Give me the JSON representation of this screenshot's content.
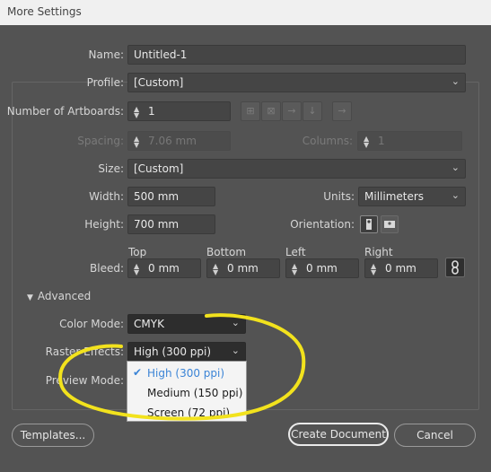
{
  "window": {
    "title": "More Settings"
  },
  "name": {
    "label": "Name:",
    "value": "Untitled-1"
  },
  "profile": {
    "label": "Profile:",
    "value": "[Custom]"
  },
  "artboards": {
    "label": "Number of Artboards:",
    "value": "1"
  },
  "spacing": {
    "label": "Spacing:",
    "value": "7.06 mm"
  },
  "columns": {
    "label": "Columns:",
    "value": "1"
  },
  "size": {
    "label": "Size:",
    "value": "[Custom]"
  },
  "width": {
    "label": "Width:",
    "value": "500 mm"
  },
  "units": {
    "label": "Units:",
    "value": "Millimeters"
  },
  "height": {
    "label": "Height:",
    "value": "700 mm"
  },
  "orientation": {
    "label": "Orientation:"
  },
  "bleed": {
    "label": "Bleed:",
    "top": {
      "label": "Top",
      "value": "0 mm"
    },
    "bottom": {
      "label": "Bottom",
      "value": "0 mm"
    },
    "left": {
      "label": "Left",
      "value": "0 mm"
    },
    "right": {
      "label": "Right",
      "value": "0 mm"
    }
  },
  "advanced": {
    "label": "Advanced"
  },
  "color_mode": {
    "label": "Color Mode:",
    "value": "CMYK"
  },
  "raster_effects": {
    "label": "Raster Effects:",
    "value": "High (300 ppi)",
    "options": [
      "High (300 ppi)",
      "Medium (150 ppi)",
      "Screen (72 ppi)"
    ]
  },
  "preview_mode": {
    "label": "Preview Mode:"
  },
  "buttons": {
    "templates": "Templates...",
    "create": "Create Document",
    "cancel": "Cancel"
  },
  "colors": {
    "highlight": "#f2e21d",
    "selected_option": "#3b84d6"
  }
}
